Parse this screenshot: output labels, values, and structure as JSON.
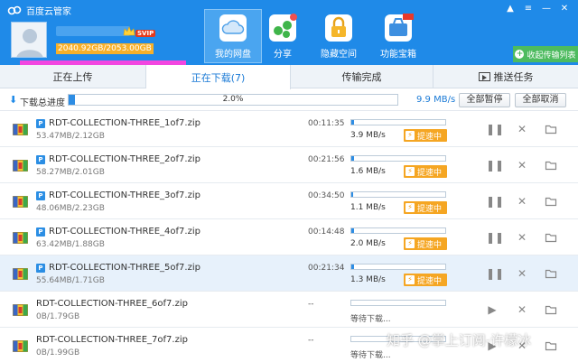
{
  "app": {
    "title": "百度云管家"
  },
  "user": {
    "badge": "SVIP",
    "quota": "2040.92GB/2053.00GB"
  },
  "nav": [
    {
      "label": "我的网盘",
      "icon": "cloud-drive-icon"
    },
    {
      "label": "分享",
      "icon": "share-icon"
    },
    {
      "label": "隐藏空间",
      "icon": "lock-icon"
    },
    {
      "label": "功能宝箱",
      "icon": "toolbox-icon",
      "badge": "NEW"
    }
  ],
  "transfer_list_label": "收起传输列表",
  "tabs": [
    {
      "label": "正在上传"
    },
    {
      "label": "正在下载(7)"
    },
    {
      "label": "传输完成"
    },
    {
      "label": "推送任务"
    }
  ],
  "total": {
    "label": "下载总进度",
    "percent_text": "2.0%",
    "percent": 2.0,
    "speed": "9.9 MB/s",
    "pause_all": "全部暂停",
    "cancel_all": "全部取消"
  },
  "boost_label": "提速中",
  "downloads": [
    {
      "name": "RDT-COLLECTION-THREE_1of7.zip",
      "size": "53.47MB/2.12GB",
      "time": "00:11:35",
      "speed": "3.9 MB/s",
      "progress": 2.5,
      "highlight": false
    },
    {
      "name": "RDT-COLLECTION-THREE_2of7.zip",
      "size": "58.27MB/2.01GB",
      "time": "00:21:56",
      "speed": "1.6 MB/s",
      "progress": 2.8,
      "highlight": false
    },
    {
      "name": "RDT-COLLECTION-THREE_3of7.zip",
      "size": "48.06MB/2.23GB",
      "time": "00:34:50",
      "speed": "1.1 MB/s",
      "progress": 2.1,
      "highlight": false
    },
    {
      "name": "RDT-COLLECTION-THREE_4of7.zip",
      "size": "63.42MB/1.88GB",
      "time": "00:14:48",
      "speed": "2.0 MB/s",
      "progress": 3.3,
      "highlight": false
    },
    {
      "name": "RDT-COLLECTION-THREE_5of7.zip",
      "size": "55.64MB/1.71GB",
      "time": "00:21:34",
      "speed": "1.3 MB/s",
      "progress": 3.2,
      "highlight": true
    },
    {
      "name": "RDT-COLLECTION-THREE_6of7.zip",
      "size": "0B/1.79GB",
      "time": "--",
      "status": "等待下载...",
      "progress": 0,
      "highlight": false
    },
    {
      "name": "RDT-COLLECTION-THREE_7of7.zip",
      "size": "0B/1.99GB",
      "time": "--",
      "status": "等待下载...",
      "progress": 0,
      "highlight": false
    }
  ],
  "watermark": "知乎 @掌上订阅-许檬冰",
  "colors": {
    "header_blue": "#1f8ae8",
    "progress_blue": "#2d8de4",
    "boost_orange": "#f5a623",
    "green": "#4dbb5f"
  }
}
